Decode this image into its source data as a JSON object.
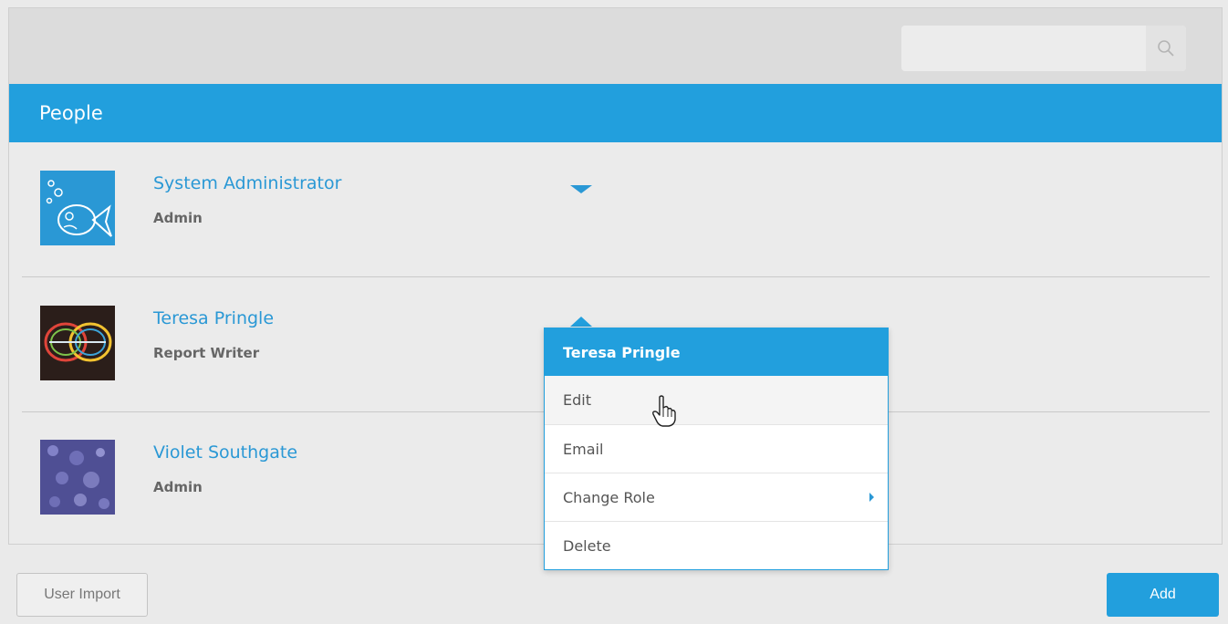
{
  "search": {
    "placeholder": "",
    "value": ""
  },
  "section": {
    "title": "People"
  },
  "people": [
    {
      "name": "System Administrator",
      "role": "Admin"
    },
    {
      "name": "Teresa Pringle",
      "role": "Report Writer"
    },
    {
      "name": "Violet Southgate",
      "role": "Admin"
    }
  ],
  "context_menu": {
    "title": "Teresa Pringle",
    "items": [
      "Edit",
      "Email",
      "Change Role",
      "Delete"
    ]
  },
  "footer": {
    "import_label": "User Import",
    "add_label": "Add"
  },
  "colors": {
    "accent": "#229fdd",
    "link": "#2a98d5"
  }
}
